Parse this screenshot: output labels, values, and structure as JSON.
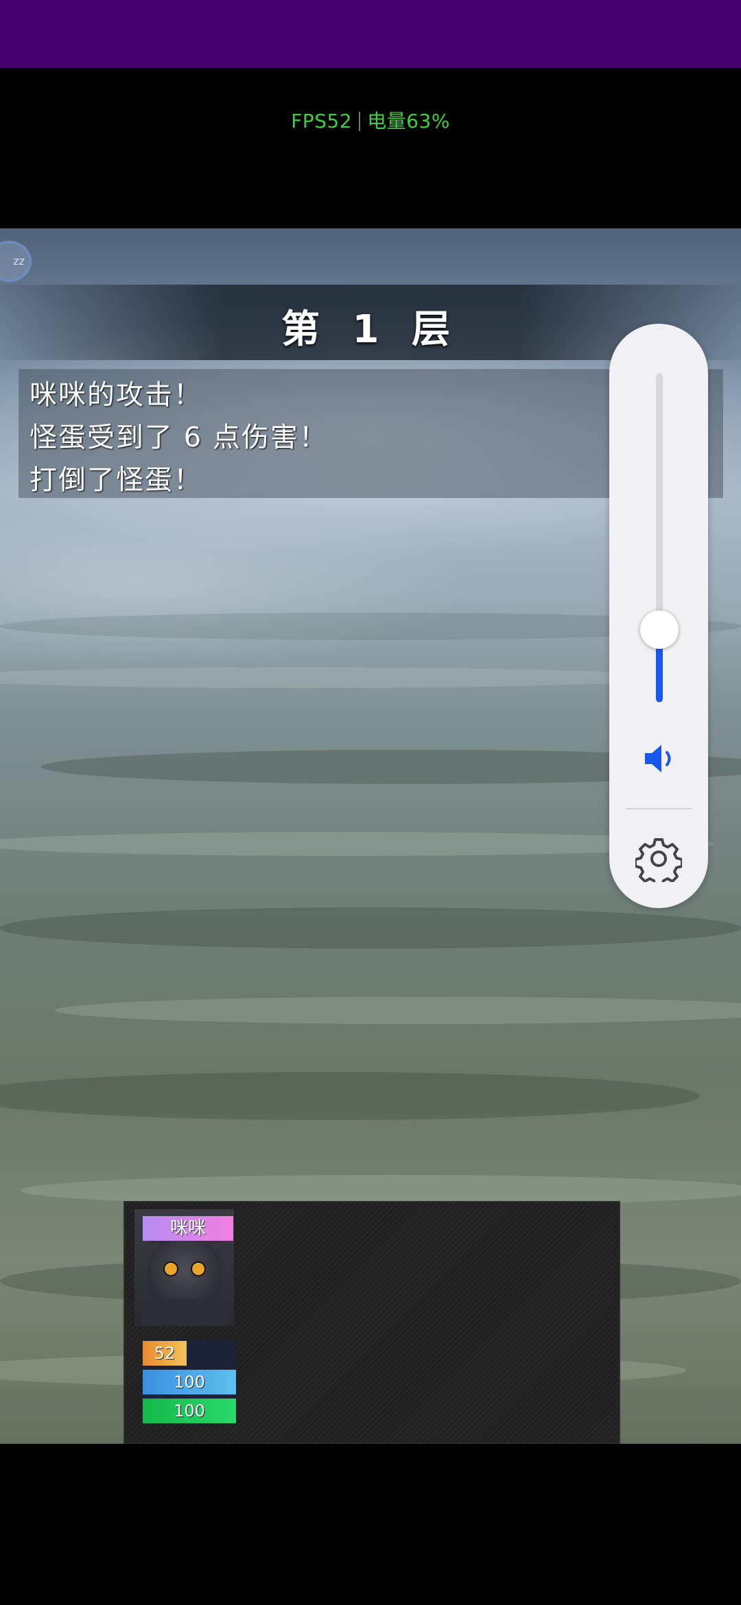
{
  "status_bar": {
    "fps_label": "FPS52",
    "battery_label": "电量63%",
    "accent_color": "#3dd13d"
  },
  "game": {
    "floor_title": "第 1 层",
    "sleep_button_label": "zz",
    "messages": [
      "咪咪的攻击！",
      "怪蛋受到了 6 点伤害！",
      "打倒了怪蛋！"
    ],
    "party": {
      "member_name": "咪咪",
      "portrait_icon": "black-cat-portrait",
      "hp": {
        "value": "52",
        "fraction": 0.47,
        "color": "#e98b2e"
      },
      "mp": {
        "value": "100",
        "fraction": 1.0,
        "color": "#3b8fe0"
      },
      "tp": {
        "value": "100",
        "fraction": 1.0,
        "color": "#14b84a"
      }
    }
  },
  "volume_panel": {
    "level": 0.22,
    "accent_color": "#1a56f0",
    "speaker_icon": "speaker-icon",
    "settings_icon": "gear-icon"
  }
}
